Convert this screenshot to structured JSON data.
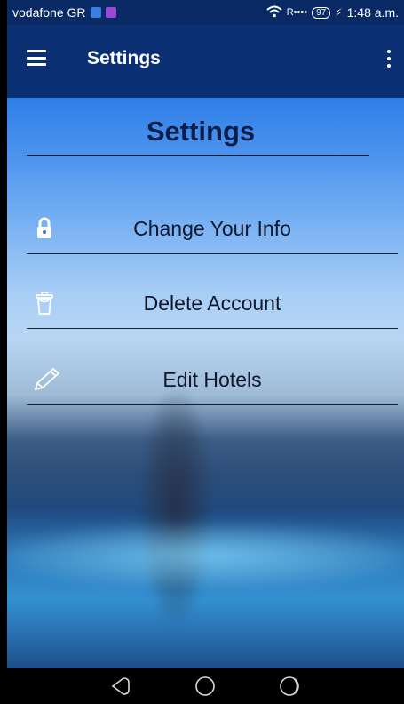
{
  "status_bar": {
    "carrier": "vodafone GR",
    "signal_text": "R",
    "battery": "97",
    "time": "1:48 a.m."
  },
  "appbar": {
    "title": "Settings"
  },
  "page": {
    "title": "Settings",
    "items": [
      {
        "label": "Change Your Info",
        "icon": "lock-icon"
      },
      {
        "label": "Delete Account",
        "icon": "trash-icon"
      },
      {
        "label": "Edit Hotels",
        "icon": "pencil-icon"
      }
    ]
  },
  "colors": {
    "appbar": "#0a2f73",
    "status_bar": "#0a2a66",
    "title_text": "#0b1e4a"
  }
}
